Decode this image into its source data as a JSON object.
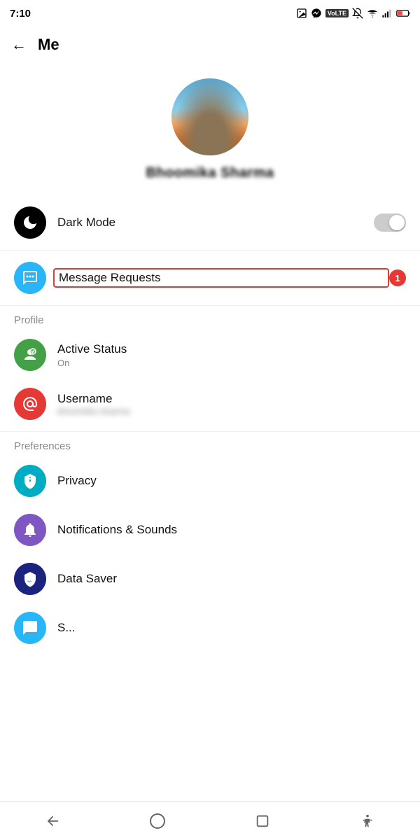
{
  "statusBar": {
    "time": "7:10",
    "volteBadge": "VoLTE",
    "icons": [
      "gallery",
      "messenger",
      "bell-off",
      "wifi",
      "signal",
      "battery"
    ]
  },
  "topNav": {
    "backLabel": "←",
    "title": "Me"
  },
  "profile": {
    "name": "Bhoomika Sharma"
  },
  "menuItems": {
    "darkMode": {
      "label": "Dark Mode",
      "iconBg": "#000000",
      "iconColor": "#fff"
    },
    "messageRequests": {
      "label": "Message Requests",
      "iconBg": "#29b6f6",
      "badge": "1"
    }
  },
  "sections": {
    "profile": {
      "label": "Profile",
      "items": [
        {
          "id": "active-status",
          "label": "Active Status",
          "subtitle": "On",
          "iconBg": "#43a047",
          "icon": "person"
        },
        {
          "id": "username",
          "label": "Username",
          "subtitle": "••••• •••••••",
          "iconBg": "#e53935",
          "icon": "at"
        }
      ]
    },
    "preferences": {
      "label": "Preferences",
      "items": [
        {
          "id": "privacy",
          "label": "Privacy",
          "iconBg": "#00acc1",
          "icon": "shield"
        },
        {
          "id": "notifications",
          "label": "Notifications & Sounds",
          "iconBg": "#7e57c2",
          "icon": "bell"
        },
        {
          "id": "data-saver",
          "label": "Data Saver",
          "iconBg": "#1a237e",
          "icon": "wifi-shield"
        },
        {
          "id": "sms",
          "label": "S...",
          "iconBg": "#29b6f6",
          "icon": "chat"
        }
      ]
    }
  },
  "bottomNav": {
    "items": [
      "back-triangle",
      "home-circle",
      "square",
      "person-icon"
    ]
  }
}
